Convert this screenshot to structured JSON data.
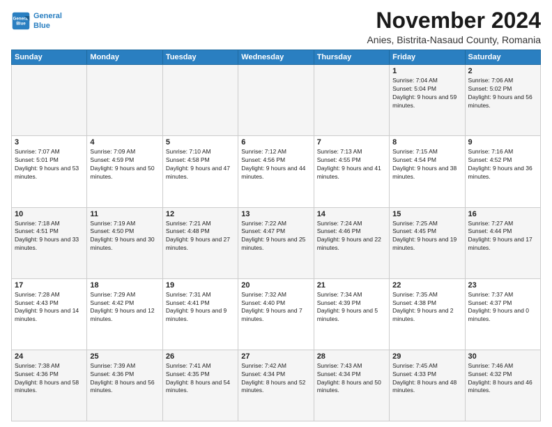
{
  "header": {
    "logo_line1": "General",
    "logo_line2": "Blue",
    "month": "November 2024",
    "location": "Anies, Bistrita-Nasaud County, Romania"
  },
  "weekdays": [
    "Sunday",
    "Monday",
    "Tuesday",
    "Wednesday",
    "Thursday",
    "Friday",
    "Saturday"
  ],
  "weeks": [
    [
      {
        "day": "",
        "content": ""
      },
      {
        "day": "",
        "content": ""
      },
      {
        "day": "",
        "content": ""
      },
      {
        "day": "",
        "content": ""
      },
      {
        "day": "",
        "content": ""
      },
      {
        "day": "1",
        "content": "Sunrise: 7:04 AM\nSunset: 5:04 PM\nDaylight: 9 hours and 59 minutes."
      },
      {
        "day": "2",
        "content": "Sunrise: 7:06 AM\nSunset: 5:02 PM\nDaylight: 9 hours and 56 minutes."
      }
    ],
    [
      {
        "day": "3",
        "content": "Sunrise: 7:07 AM\nSunset: 5:01 PM\nDaylight: 9 hours and 53 minutes."
      },
      {
        "day": "4",
        "content": "Sunrise: 7:09 AM\nSunset: 4:59 PM\nDaylight: 9 hours and 50 minutes."
      },
      {
        "day": "5",
        "content": "Sunrise: 7:10 AM\nSunset: 4:58 PM\nDaylight: 9 hours and 47 minutes."
      },
      {
        "day": "6",
        "content": "Sunrise: 7:12 AM\nSunset: 4:56 PM\nDaylight: 9 hours and 44 minutes."
      },
      {
        "day": "7",
        "content": "Sunrise: 7:13 AM\nSunset: 4:55 PM\nDaylight: 9 hours and 41 minutes."
      },
      {
        "day": "8",
        "content": "Sunrise: 7:15 AM\nSunset: 4:54 PM\nDaylight: 9 hours and 38 minutes."
      },
      {
        "day": "9",
        "content": "Sunrise: 7:16 AM\nSunset: 4:52 PM\nDaylight: 9 hours and 36 minutes."
      }
    ],
    [
      {
        "day": "10",
        "content": "Sunrise: 7:18 AM\nSunset: 4:51 PM\nDaylight: 9 hours and 33 minutes."
      },
      {
        "day": "11",
        "content": "Sunrise: 7:19 AM\nSunset: 4:50 PM\nDaylight: 9 hours and 30 minutes."
      },
      {
        "day": "12",
        "content": "Sunrise: 7:21 AM\nSunset: 4:48 PM\nDaylight: 9 hours and 27 minutes."
      },
      {
        "day": "13",
        "content": "Sunrise: 7:22 AM\nSunset: 4:47 PM\nDaylight: 9 hours and 25 minutes."
      },
      {
        "day": "14",
        "content": "Sunrise: 7:24 AM\nSunset: 4:46 PM\nDaylight: 9 hours and 22 minutes."
      },
      {
        "day": "15",
        "content": "Sunrise: 7:25 AM\nSunset: 4:45 PM\nDaylight: 9 hours and 19 minutes."
      },
      {
        "day": "16",
        "content": "Sunrise: 7:27 AM\nSunset: 4:44 PM\nDaylight: 9 hours and 17 minutes."
      }
    ],
    [
      {
        "day": "17",
        "content": "Sunrise: 7:28 AM\nSunset: 4:43 PM\nDaylight: 9 hours and 14 minutes."
      },
      {
        "day": "18",
        "content": "Sunrise: 7:29 AM\nSunset: 4:42 PM\nDaylight: 9 hours and 12 minutes."
      },
      {
        "day": "19",
        "content": "Sunrise: 7:31 AM\nSunset: 4:41 PM\nDaylight: 9 hours and 9 minutes."
      },
      {
        "day": "20",
        "content": "Sunrise: 7:32 AM\nSunset: 4:40 PM\nDaylight: 9 hours and 7 minutes."
      },
      {
        "day": "21",
        "content": "Sunrise: 7:34 AM\nSunset: 4:39 PM\nDaylight: 9 hours and 5 minutes."
      },
      {
        "day": "22",
        "content": "Sunrise: 7:35 AM\nSunset: 4:38 PM\nDaylight: 9 hours and 2 minutes."
      },
      {
        "day": "23",
        "content": "Sunrise: 7:37 AM\nSunset: 4:37 PM\nDaylight: 9 hours and 0 minutes."
      }
    ],
    [
      {
        "day": "24",
        "content": "Sunrise: 7:38 AM\nSunset: 4:36 PM\nDaylight: 8 hours and 58 minutes."
      },
      {
        "day": "25",
        "content": "Sunrise: 7:39 AM\nSunset: 4:36 PM\nDaylight: 8 hours and 56 minutes."
      },
      {
        "day": "26",
        "content": "Sunrise: 7:41 AM\nSunset: 4:35 PM\nDaylight: 8 hours and 54 minutes."
      },
      {
        "day": "27",
        "content": "Sunrise: 7:42 AM\nSunset: 4:34 PM\nDaylight: 8 hours and 52 minutes."
      },
      {
        "day": "28",
        "content": "Sunrise: 7:43 AM\nSunset: 4:34 PM\nDaylight: 8 hours and 50 minutes."
      },
      {
        "day": "29",
        "content": "Sunrise: 7:45 AM\nSunset: 4:33 PM\nDaylight: 8 hours and 48 minutes."
      },
      {
        "day": "30",
        "content": "Sunrise: 7:46 AM\nSunset: 4:32 PM\nDaylight: 8 hours and 46 minutes."
      }
    ]
  ],
  "colors": {
    "header_bg": "#2a7fc1",
    "logo_blue": "#2a7fc1"
  }
}
